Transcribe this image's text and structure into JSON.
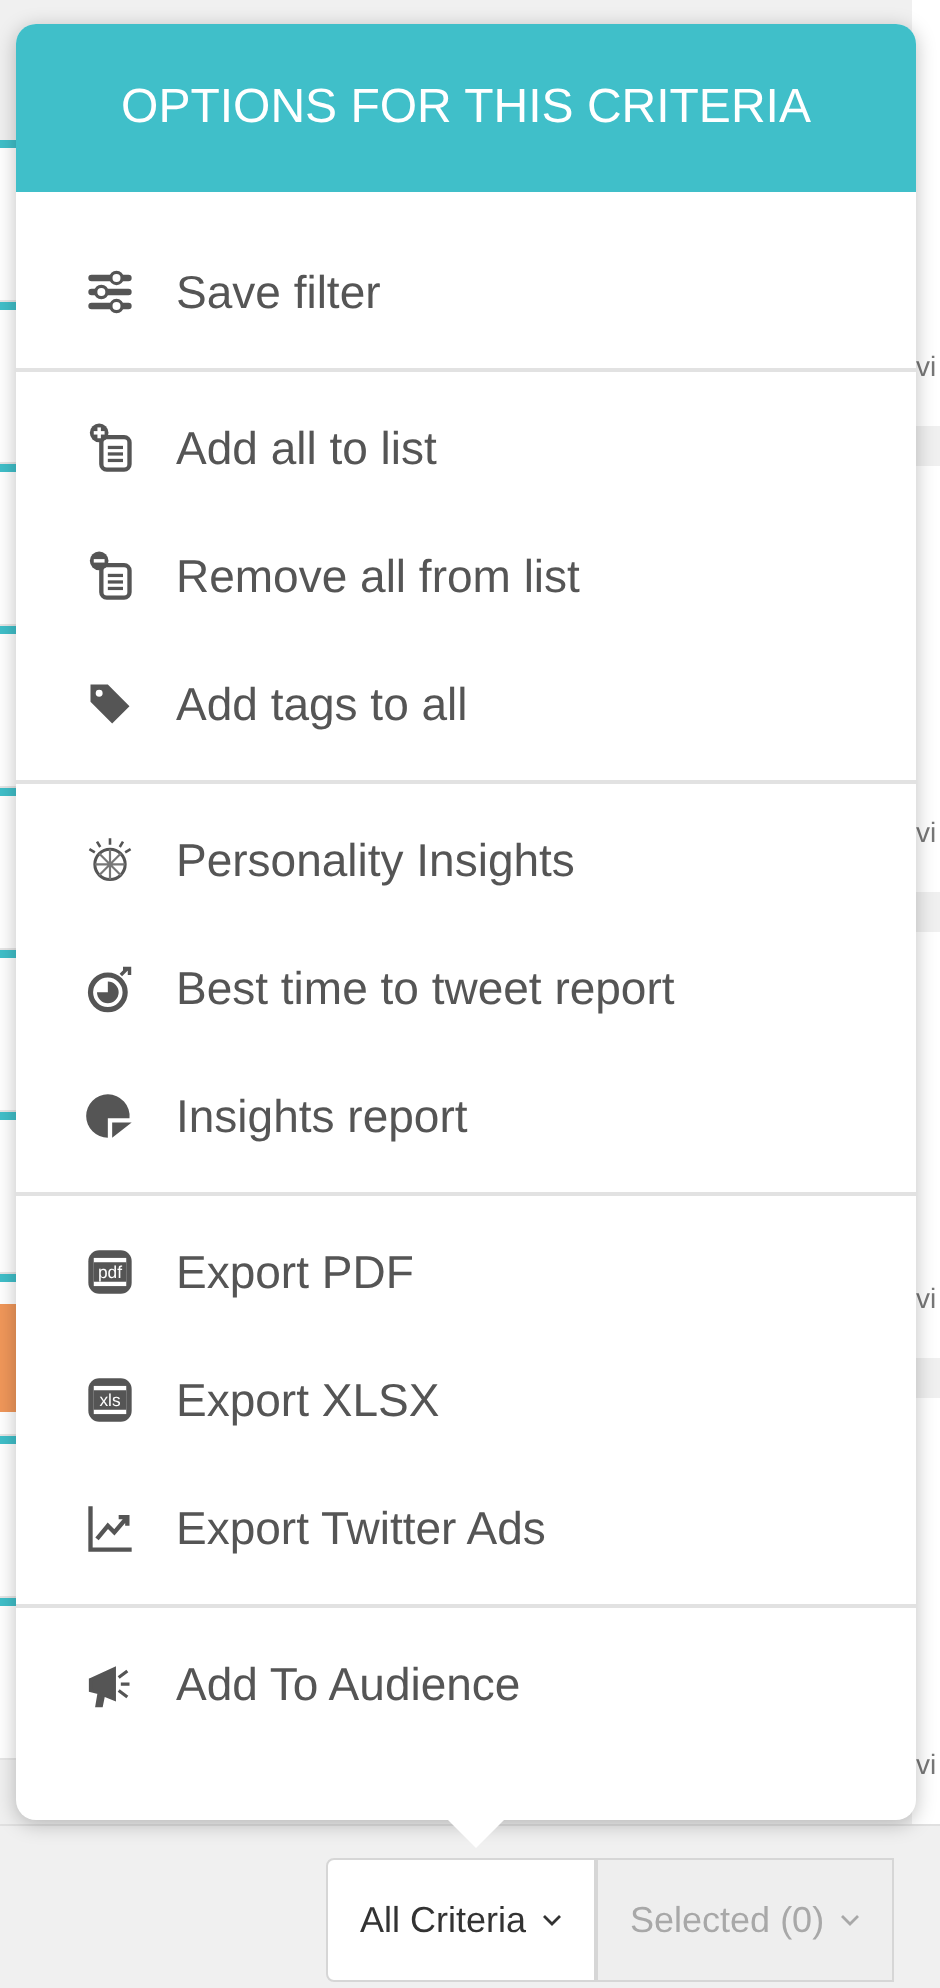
{
  "right_cards": [
    {
      "text": "vi"
    },
    {
      "text": "vi"
    },
    {
      "text": "vi"
    },
    {
      "text": "vi"
    }
  ],
  "popup": {
    "title": "OPTIONS FOR THIS CRITERIA",
    "groups": [
      {
        "items": [
          {
            "label": "Save filter",
            "kind": "sliders"
          }
        ]
      },
      {
        "items": [
          {
            "label": "Add all to list",
            "kind": "list-add"
          },
          {
            "label": "Remove all from list",
            "kind": "list-remove"
          },
          {
            "label": "Add tags to all",
            "kind": "tag"
          }
        ]
      },
      {
        "items": [
          {
            "label": "Personality Insights",
            "kind": "globe"
          },
          {
            "label": "Best time to tweet report",
            "kind": "clock"
          },
          {
            "label": "Insights report",
            "kind": "pie"
          }
        ]
      },
      {
        "items": [
          {
            "label": "Export PDF",
            "kind": "file",
            "badge": "pdf"
          },
          {
            "label": "Export XLSX",
            "kind": "file",
            "badge": "xls"
          },
          {
            "label": "Export Twitter Ads",
            "kind": "chart"
          }
        ]
      },
      {
        "items": [
          {
            "label": "Add To Audience",
            "kind": "megaphone"
          }
        ]
      }
    ]
  },
  "tabs": [
    {
      "label": "All Criteria",
      "selected": true
    },
    {
      "label": "Selected (0)",
      "selected": false
    }
  ]
}
